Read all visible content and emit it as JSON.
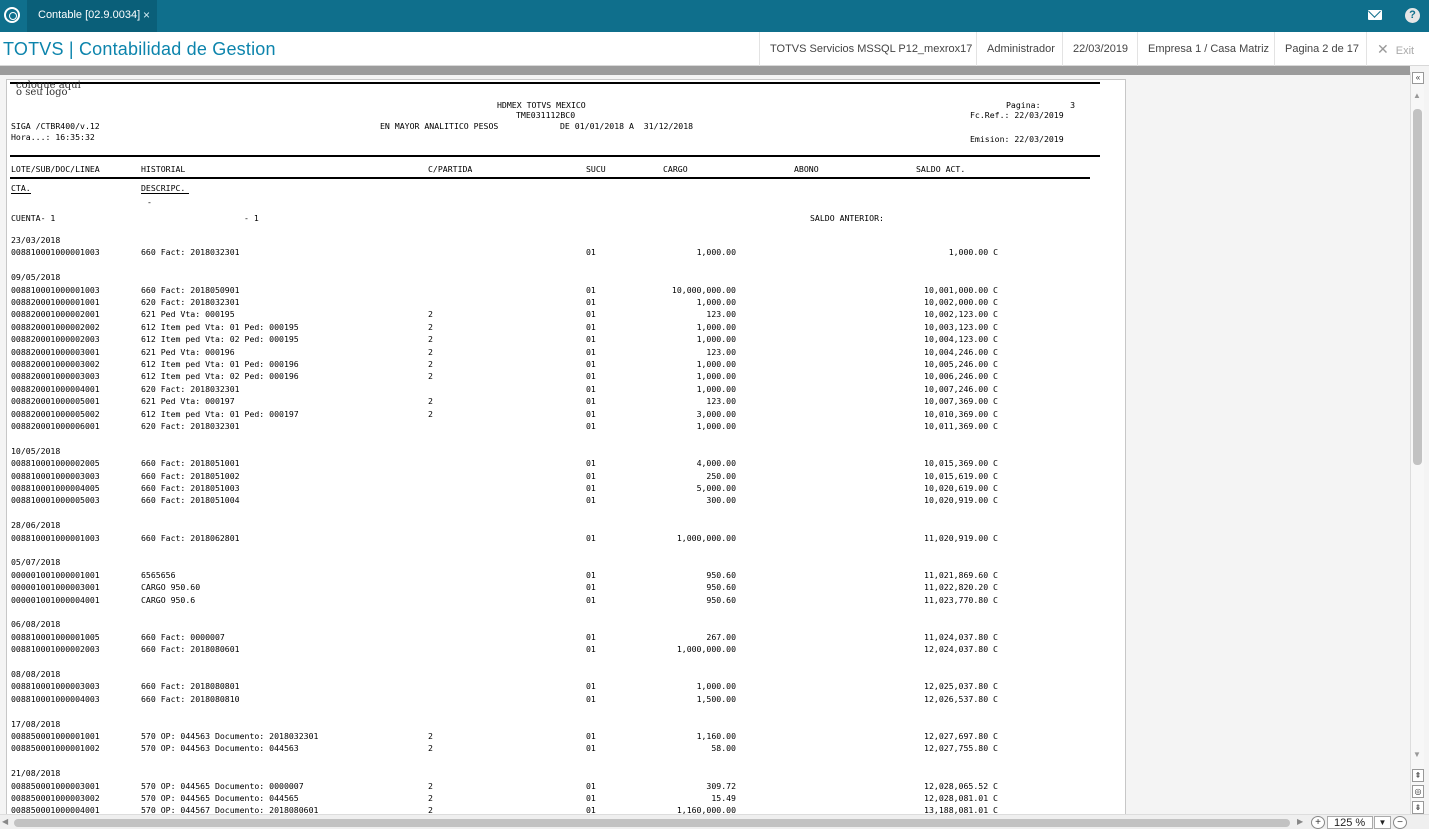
{
  "tab": {
    "label": "Contable [02.9.0034]",
    "close": "×"
  },
  "header": {
    "title": "TOTVS | Contabilidad de Gestion",
    "server": "TOTVS Servicios MSSQL P12_mexrox17",
    "user": "Administrador",
    "date": "22/03/2019",
    "company": "Empresa 1 / Casa Matriz",
    "page": "Pagina 2 de 17",
    "exit": "Exit"
  },
  "icons": {
    "logo": "totvs-logo-icon",
    "mail": "mail-icon",
    "help": "help-icon",
    "close": "close-icon"
  },
  "report": {
    "logo_line1": "coloque aqui",
    "logo_line2": "o seu logo",
    "company": "HDMEX TOTVS MEXICO",
    "rfc": "TME031112BC0",
    "program": "SIGA /CTBR400/v.12",
    "title": "EN MAYOR ANALITICO PESOS",
    "period": "DE 01/01/2018 A  31/12/2018",
    "time": "Hora...: 16:35:32",
    "pagina": "Pagina:      3",
    "fcref": "Fc.Ref.: 22/03/2019",
    "emision": "Emision: 22/03/2019",
    "columns": [
      "LOTE/SUB/DOC/LINEA",
      "HISTORIAL",
      "C/PARTIDA",
      "SUCU",
      "CARGO",
      "ABONO",
      "SALDO ACT."
    ],
    "sub_columns": [
      "CTA.",
      "DESCRIPC."
    ],
    "dash": "-",
    "cuenta": "CUENTA- 1",
    "cuenta_desc": "- 1",
    "saldo_anterior": "SALDO ANTERIOR:",
    "groups": [
      {
        "date": "23/03/2018",
        "rows": [
          [
            "008810001000001003",
            "660 Fact: 2018032301",
            "",
            "01",
            "1,000.00",
            "1,000.00 C"
          ]
        ]
      },
      {
        "date": "09/05/2018",
        "rows": [
          [
            "008810001000001003",
            "660 Fact: 2018050901",
            "",
            "01",
            "10,000,000.00",
            "10,001,000.00 C"
          ],
          [
            "008820001000001001",
            "620 Fact: 2018032301",
            "",
            "01",
            "1,000.00",
            "10,002,000.00 C"
          ],
          [
            "008820001000002001",
            "621 Ped Vta: 000195",
            "2",
            "01",
            "123.00",
            "10,002,123.00 C"
          ],
          [
            "008820001000002002",
            "612 Item ped Vta: 01 Ped: 000195",
            "2",
            "01",
            "1,000.00",
            "10,003,123.00 C"
          ],
          [
            "008820001000002003",
            "612 Item ped Vta: 02 Ped: 000195",
            "2",
            "01",
            "1,000.00",
            "10,004,123.00 C"
          ],
          [
            "008820001000003001",
            "621 Ped Vta: 000196",
            "2",
            "01",
            "123.00",
            "10,004,246.00 C"
          ],
          [
            "008820001000003002",
            "612 Item ped Vta: 01 Ped: 000196",
            "2",
            "01",
            "1,000.00",
            "10,005,246.00 C"
          ],
          [
            "008820001000003003",
            "612 Item ped Vta: 02 Ped: 000196",
            "2",
            "01",
            "1,000.00",
            "10,006,246.00 C"
          ],
          [
            "008820001000004001",
            "620 Fact: 2018032301",
            "",
            "01",
            "1,000.00",
            "10,007,246.00 C"
          ],
          [
            "008820001000005001",
            "621 Ped Vta: 000197",
            "2",
            "01",
            "123.00",
            "10,007,369.00 C"
          ],
          [
            "008820001000005002",
            "612 Item ped Vta: 01 Ped: 000197",
            "2",
            "01",
            "3,000.00",
            "10,010,369.00 C"
          ],
          [
            "008820001000006001",
            "620 Fact: 2018032301",
            "",
            "01",
            "1,000.00",
            "10,011,369.00 C"
          ]
        ]
      },
      {
        "date": "10/05/2018",
        "rows": [
          [
            "008810001000002005",
            "660 Fact: 2018051001",
            "",
            "01",
            "4,000.00",
            "10,015,369.00 C"
          ],
          [
            "008810001000003003",
            "660 Fact: 2018051002",
            "",
            "01",
            "250.00",
            "10,015,619.00 C"
          ],
          [
            "008810001000004005",
            "660 Fact: 2018051003",
            "",
            "01",
            "5,000.00",
            "10,020,619.00 C"
          ],
          [
            "008810001000005003",
            "660 Fact: 2018051004",
            "",
            "01",
            "300.00",
            "10,020,919.00 C"
          ]
        ]
      },
      {
        "date": "28/06/2018",
        "rows": [
          [
            "008810001000001003",
            "660 Fact: 2018062801",
            "",
            "01",
            "1,000,000.00",
            "11,020,919.00 C"
          ]
        ]
      },
      {
        "date": "05/07/2018",
        "rows": [
          [
            "000001001000001001",
            "6565656",
            "",
            "01",
            "950.60",
            "11,021,869.60 C"
          ],
          [
            "000001001000003001",
            "CARGO 950.60",
            "",
            "01",
            "950.60",
            "11,022,820.20 C"
          ],
          [
            "000001001000004001",
            "CARGO 950.6",
            "",
            "01",
            "950.60",
            "11,023,770.80 C"
          ]
        ]
      },
      {
        "date": "06/08/2018",
        "rows": [
          [
            "008810001000001005",
            "660 Fact: 0000007",
            "",
            "01",
            "267.00",
            "11,024,037.80 C"
          ],
          [
            "008810001000002003",
            "660 Fact: 2018080601",
            "",
            "01",
            "1,000,000.00",
            "12,024,037.80 C"
          ]
        ]
      },
      {
        "date": "08/08/2018",
        "rows": [
          [
            "008810001000003003",
            "660 Fact: 2018080801",
            "",
            "01",
            "1,000.00",
            "12,025,037.80 C"
          ],
          [
            "008810001000004003",
            "660 Fact: 2018080810",
            "",
            "01",
            "1,500.00",
            "12,026,537.80 C"
          ]
        ]
      },
      {
        "date": "17/08/2018",
        "rows": [
          [
            "008850001000001001",
            "570 OP: 044563 Documento: 2018032301",
            "2",
            "01",
            "1,160.00",
            "12,027,697.80 C"
          ],
          [
            "008850001000001002",
            "570 OP: 044563 Documento: 044563",
            "2",
            "01",
            "58.00",
            "12,027,755.80 C"
          ]
        ]
      },
      {
        "date": "21/08/2018",
        "rows": [
          [
            "008850001000003001",
            "570 OP: 044565 Documento: 0000007",
            "2",
            "01",
            "309.72",
            "12,028,065.52 C"
          ],
          [
            "008850001000003002",
            "570 OP: 044565 Documento: 044565",
            "2",
            "01",
            "15.49",
            "12,028,081.01 C"
          ],
          [
            "008850001000004001",
            "570 OP: 044567 Documento: 2018080601",
            "2",
            "01",
            "1,160,000.00",
            "13,188,081.01 C"
          ]
        ]
      }
    ]
  },
  "scroll": {
    "collapse": "«",
    "up": "▲",
    "down": "▼",
    "top": "⇞",
    "mid": "◎",
    "bottom": "⇟",
    "left": "◀",
    "right": "▶"
  },
  "zoom": {
    "value": "125 %",
    "in": "+",
    "out": "−",
    "drop": "▼"
  }
}
